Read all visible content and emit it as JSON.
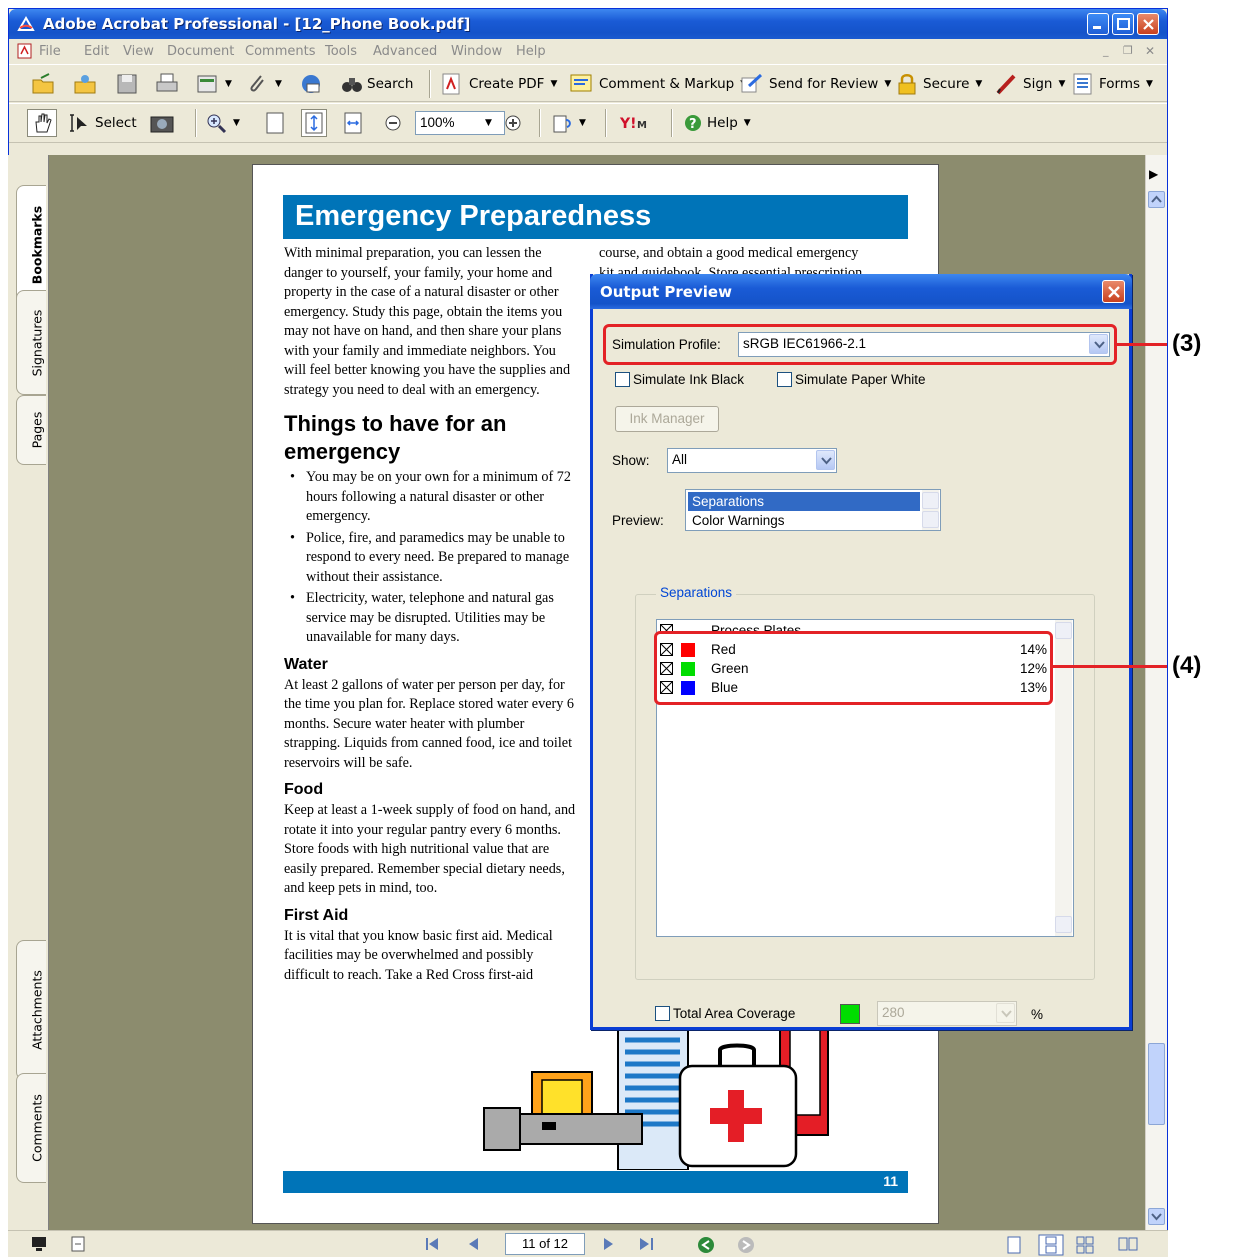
{
  "window": {
    "title": "Adobe Acrobat Professional - [12_Phone Book.pdf]"
  },
  "menubar": {
    "items": [
      "File",
      "Edit",
      "View",
      "Document",
      "Comments",
      "Tools",
      "Advanced",
      "Window",
      "Help"
    ]
  },
  "toolbar1": {
    "search_label": "Search",
    "create_pdf_label": "Create PDF",
    "comment_markup_label": "Comment & Markup",
    "send_review_label": "Send for Review",
    "secure_label": "Secure",
    "sign_label": "Sign",
    "forms_label": "Forms"
  },
  "toolbar2": {
    "select_label": "Select",
    "zoom_value": "100%",
    "help_label": "Help"
  },
  "side_tabs": [
    "Bookmarks",
    "Signatures",
    "Pages",
    "Attachments",
    "Comments"
  ],
  "page": {
    "title": "Emergency Preparedness",
    "intro": "With minimal preparation, you can lessen the danger to yourself, your family, your home and property in the case of a natural disaster or other emergency. Study this page, obtain the items you may not have on hand, and then share your plans with your family and immediate neighbors. You will feel better knowing you have the supplies and strategy you need to deal with an emergency.",
    "heading_things": "Things to have for an emergency",
    "bullets": [
      "You may be on your own for a minimum of 72 hours following a natural disaster or other emergency.",
      "Police, fire, and paramedics may be unable to respond to every need. Be prepared to manage without their assistance.",
      "Electricity, water, telephone and natural gas service may be disrupted. Utilities may be unavailable for many days."
    ],
    "heading_water": "Water",
    "water_text": "At least 2 gallons of water per person per day, for the time you plan for. Replace stored water every 6 months. Secure water heater with plumber strapping. Liquids from canned food, ice and toilet reservoirs will be safe.",
    "heading_food": "Food",
    "food_text": "Keep at least a 1-week supply of food on hand, and rotate it into your regular pantry every 6 months. Store foods with high nutritional value that are easily prepared. Remember special dietary needs, and keep pets in mind, too.",
    "heading_first_aid": "First Aid",
    "first_aid_text": "It is vital that you know basic first aid. Medical facilities may be overwhelmed and possibly difficult to reach. Take a Red Cross first-aid",
    "col2_line1": "course, and obtain a good medical emergency",
    "col2_line2": "kit and guidebook. Store essential prescription",
    "page_number": "11"
  },
  "dialog": {
    "title": "Output Preview",
    "simulation_profile_label": "Simulation Profile:",
    "simulation_profile_value": "sRGB IEC61966-2.1",
    "simulate_ink_black_label": "Simulate Ink Black",
    "simulate_paper_white_label": "Simulate Paper White",
    "ink_manager_label": "Ink Manager",
    "show_label": "Show:",
    "show_value": "All",
    "preview_label": "Preview:",
    "preview_options": [
      "Separations",
      "Color Warnings"
    ],
    "separations_group_label": "Separations",
    "process_plates_label": "Process Plates",
    "separations": [
      {
        "name": "Red",
        "percent": "14%",
        "color": "#ff0000"
      },
      {
        "name": "Green",
        "percent": "12%",
        "color": "#00dd00"
      },
      {
        "name": "Blue",
        "percent": "13%",
        "color": "#0000ff"
      }
    ],
    "total_area_coverage_label": "Total Area Coverage",
    "total_area_coverage_value": "280",
    "percent_sign": "%"
  },
  "callouts": {
    "label_3": "(3)",
    "label_4": "(4)"
  },
  "statusbar": {
    "page_indicator": "11 of 12"
  },
  "colors": {
    "title_bar_blue": "#0a3ed4",
    "page_accent": "#0074b8",
    "callout_red": "#e32226"
  }
}
